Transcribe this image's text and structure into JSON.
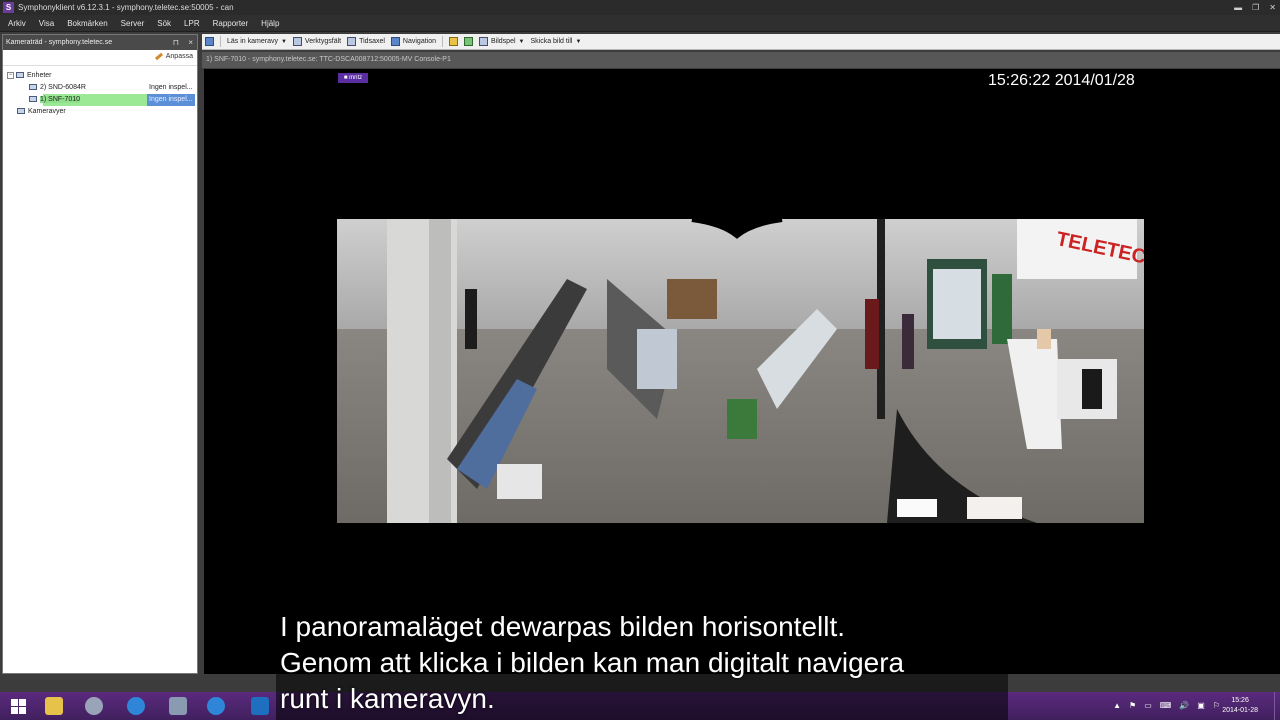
{
  "window": {
    "title": "Symphonyklient v6.12.3.1 - symphony.teletec.se:50005 - can",
    "app_icon": "S",
    "controls": [
      "minimize-icon",
      "restore-icon",
      "close-icon"
    ]
  },
  "menu": [
    "Arkiv",
    "Visa",
    "Bokmärken",
    "Server",
    "Sök",
    "LPR",
    "Rapporter",
    "Hjälp"
  ],
  "left_panel": {
    "title": "Kameraträd - symphony.teletec.se",
    "pin": "⊓",
    "close": "×",
    "adjust_label": "Anpassa",
    "tree": {
      "devices_label": "Enheter",
      "devices": [
        {
          "name": "2) SND-6084R",
          "status": "Ingen inspel..."
        },
        {
          "name": "1) SNF-7010",
          "status": "Ingen inspel..."
        }
      ],
      "views_label": "Kameravyer"
    }
  },
  "toolbar": {
    "load_view": "Läs in kameravy",
    "tools": "Verktygsfält",
    "timeline": "Tidsaxel",
    "navigation": "Navigation",
    "slideshow": "Bildspel",
    "send_image": "Skicka bild till"
  },
  "viewport": {
    "header": "1) SNF-7010 - symphony.teletec.se: TTC-DSCA008712:50005-MV Console-P1",
    "timestamp": "15:26:22 2014/01/28",
    "logo": "■ mntz"
  },
  "subtitles": [
    "I panoramaläget dewarpas bilden horisontellt.",
    "Genom att klicka i bilden kan man digitalt navigera",
    "runt i kameravyn."
  ],
  "taskbar": {
    "clock_time": "15:26",
    "clock_date": "2014-01-28",
    "tray_icons": [
      "▲",
      "⚑",
      "▭",
      "⌨",
      "🔊",
      "▣",
      "⚐"
    ]
  }
}
